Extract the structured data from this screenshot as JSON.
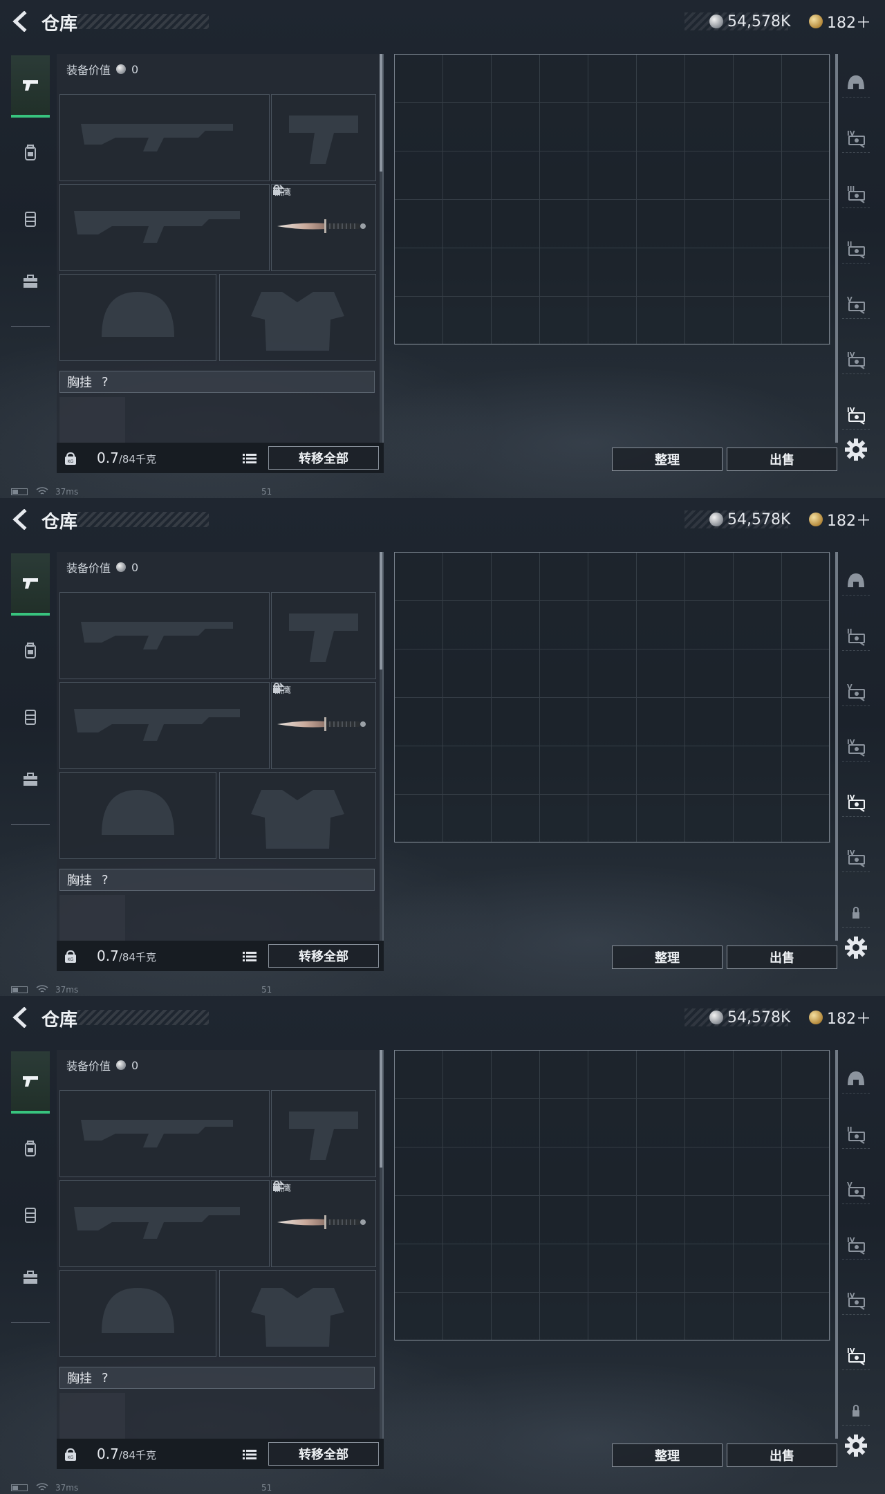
{
  "screens": [
    {
      "rail_icons": [
        "helmet-icon",
        "armor-tier-IV-icon",
        "ammo-tier-III-icon",
        "ammo-tier-II-icon",
        "ammo-tier-V-icon",
        "ammo-tier-IV-icon",
        "ammo-tier-IV-selected-icon"
      ]
    },
    {
      "rail_icons": [
        "helmet-icon",
        "ammo-tier-II-icon",
        "ammo-tier-V-icon",
        "ammo-tier-IV-icon",
        "ammo-tier-IV-selected-icon",
        "ammo-tier-IV-icon",
        "lock-icon"
      ]
    },
    {
      "rail_icons": [
        "helmet-icon",
        "ammo-tier-II-icon",
        "ammo-tier-V-icon",
        "ammo-tier-IV-icon",
        "ammo-tier-IV-icon",
        "ammo-tier-IV-selected-icon",
        "lock-icon"
      ]
    }
  ],
  "topbar": {
    "title": "仓库",
    "silver_amount": "54,578K",
    "gold_amount": "182＋"
  },
  "equipment": {
    "value_label": "装备价值",
    "value": "0",
    "melee_tag": "黑鹰",
    "chest_label": "胸挂",
    "chest_help": "?",
    "weight_current": "0.7",
    "weight_max": "/84千克",
    "transfer_all": "转移全部"
  },
  "actions": {
    "sort": "整理",
    "sell": "出售"
  },
  "status": {
    "ping": "37ms",
    "fps": "51"
  },
  "colors": {
    "accent_green": "#38c47e",
    "panel_bg": "#262c35",
    "border": "#8a929c"
  },
  "nav_icons": [
    "weapon-icon",
    "backpack-icon",
    "vest-icon",
    "toolbox-icon"
  ]
}
